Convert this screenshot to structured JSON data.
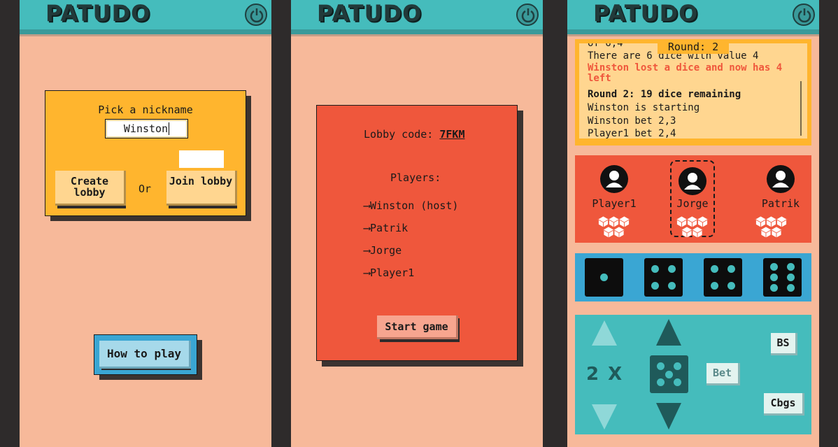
{
  "brand": "PATUDO",
  "colors": {
    "teal": "#45bcbc",
    "salmon": "#f7b99a",
    "orange_red": "#ef573c",
    "yellow": "#ffb52e",
    "blue": "#3aa6d3"
  },
  "screen1": {
    "nickname_title": "Pick a nickname",
    "nickname_value": "Winston",
    "create_lobby": "Create lobby",
    "or": "Or",
    "join_lobby": "Join lobby",
    "how_to_play": "How to play"
  },
  "screen2": {
    "lobby_code_label": "Lobby code:",
    "lobby_code": "7FKM",
    "players_label": "Players:",
    "players": [
      "Winston (host)",
      "Patrik",
      "Jorge",
      "Player1"
    ],
    "start_game": "Start game"
  },
  "screen3": {
    "round_badge": "Round: 2",
    "log": {
      "clipped": "of 6,4",
      "line1": "There are 6 dice with value 4",
      "line2": "Winston lost a dice and now has 4 left",
      "line3": "Round 2: 19 dice remaining",
      "line4": "Winston is starting",
      "line5": "Winston bet 2,3",
      "line6": "Player1 bet 2,4"
    },
    "players": [
      {
        "name": "Player1",
        "dice_count": 5
      },
      {
        "name": "Jorge",
        "dice_count": 5
      },
      {
        "name": "Patrik",
        "dice_count": 5
      }
    ],
    "hand": [
      1,
      4,
      4,
      6
    ],
    "bet_quantity": "2 X",
    "bet_face": 5,
    "bet_button": "Bet",
    "bs_button": "BS",
    "cbgs_button": "Cbgs"
  }
}
